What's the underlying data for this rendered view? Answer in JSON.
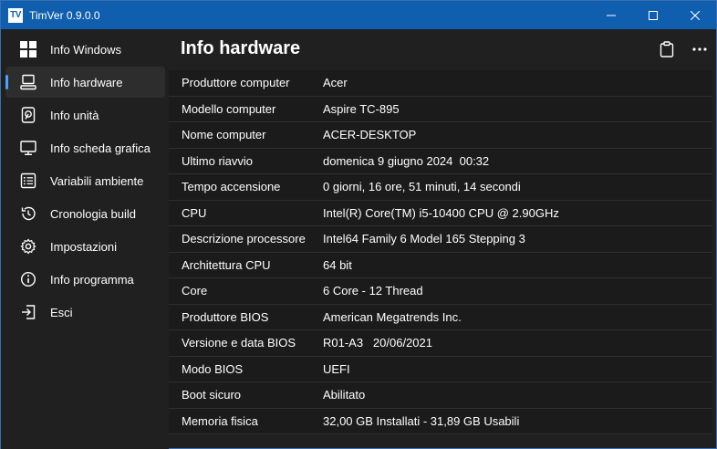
{
  "window": {
    "icon_text": "TV",
    "title": "TimVer  0.9.0.0",
    "controls": [
      "minimize-icon",
      "maximize-icon",
      "close-icon"
    ]
  },
  "sidebar": {
    "items": [
      {
        "label": "Info Windows",
        "icon": "windows-logo-icon",
        "active": false
      },
      {
        "label": "Info hardware",
        "icon": "computer-icon",
        "active": true
      },
      {
        "label": "Info unità",
        "icon": "drive-icon",
        "active": false
      },
      {
        "label": "Info scheda grafica",
        "icon": "monitor-icon",
        "active": false
      },
      {
        "label": "Variabili ambiente",
        "icon": "list-icon",
        "active": false
      },
      {
        "label": "Cronologia build",
        "icon": "history-icon",
        "active": false
      },
      {
        "label": "Impostazioni",
        "icon": "gear-icon",
        "active": false
      },
      {
        "label": "Info programma",
        "icon": "info-icon",
        "active": false
      },
      {
        "label": "Esci",
        "icon": "exit-icon",
        "active": false
      }
    ]
  },
  "main": {
    "title": "Info hardware",
    "actions": [
      "clipboard-icon",
      "more-icon"
    ],
    "rows": [
      {
        "label": "Produttore computer",
        "value": "Acer"
      },
      {
        "label": "Modello computer",
        "value": "Aspire TC-895"
      },
      {
        "label": "Nome computer",
        "value": "ACER-DESKTOP"
      },
      {
        "label": "Ultimo riavvio",
        "value": "domenica 9 giugno 2024  00:32"
      },
      {
        "label": "Tempo accensione",
        "value": "0 giorni, 16 ore, 51 minuti, 14 secondi"
      },
      {
        "label": "CPU",
        "value": "Intel(R) Core(TM) i5-10400 CPU @ 2.90GHz"
      },
      {
        "label": "Descrizione processore",
        "value": "Intel64 Family 6 Model 165 Stepping 3"
      },
      {
        "label": "Architettura CPU",
        "value": "64 bit"
      },
      {
        "label": "Core",
        "value": "6 Core - 12 Thread"
      },
      {
        "label": "Produttore BIOS",
        "value": "American Megatrends Inc."
      },
      {
        "label": "Versione e data BIOS",
        "value": "R01-A3   20/06/2021"
      },
      {
        "label": "Modo BIOS",
        "value": "UEFI"
      },
      {
        "label": "Boot sicuro",
        "value": "Abilitato"
      },
      {
        "label": "Memoria fisica",
        "value": "32,00 GB Installati - 31,89 GB Usabili"
      }
    ]
  },
  "colors": {
    "titlebar": "#0f5fae",
    "background": "#202020",
    "accent": "#4ca0ff",
    "row_background": "#1b1b1b"
  }
}
